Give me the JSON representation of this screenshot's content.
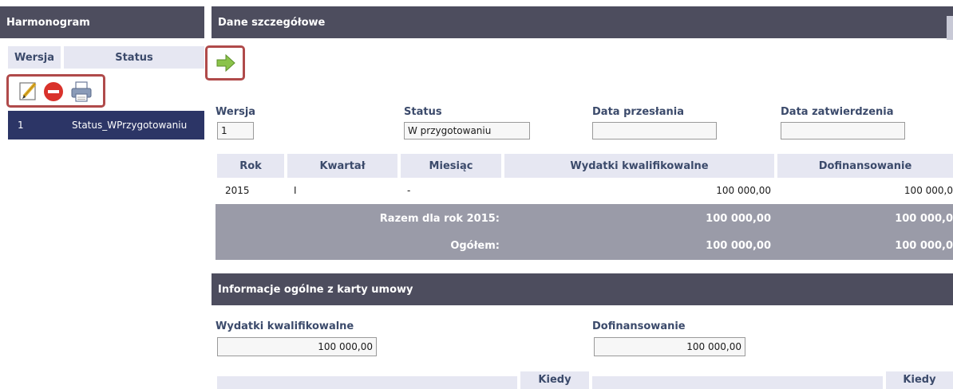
{
  "left": {
    "title": "Harmonogram",
    "col_version": "Wersja",
    "col_status": "Status",
    "rows": [
      {
        "version": "1",
        "status": "Status_WPrzygotowaniu"
      }
    ]
  },
  "details": {
    "title": "Dane szczegółowe",
    "fields": {
      "version_label": "Wersja",
      "version_value": "1",
      "status_label": "Status",
      "status_value": "W przygotowaniu",
      "sent_label": "Data przesłania",
      "sent_value": "",
      "approved_label": "Data zatwierdzenia",
      "approved_value": ""
    },
    "table": {
      "headers": [
        "Rok",
        "Kwartał",
        "Miesiąc",
        "Wydatki kwalifikowalne",
        "Dofinansowanie"
      ],
      "row": {
        "year": "2015",
        "quarter": "I",
        "month": "-",
        "eligible": "100 000,00",
        "funding": "100 000,0"
      },
      "year_total_label": "Razem dla rok 2015:",
      "year_total_eligible": "100 000,00",
      "year_total_funding": "100 000,0",
      "grand_total_label": "Ogółem:",
      "grand_total_eligible": "100 000,00",
      "grand_total_funding": "100 000,0"
    }
  },
  "contract": {
    "title": "Informacje ogólne z karty umowy",
    "eligible_label": "Wydatki kwalifikowalne",
    "eligible_value": "100 000,00",
    "funding_label": "Dofinansowanie",
    "funding_value": "100 000,00",
    "bottom_header_1": "Kiedy",
    "bottom_header_2": "Kiedy"
  },
  "colors": {
    "header_bg": "#4d4d5e",
    "table_header_bg": "#e6e7f2",
    "summary_bg": "#9a9ba8",
    "highlight": "#b04a4a",
    "selected_row": "#2c3566"
  }
}
